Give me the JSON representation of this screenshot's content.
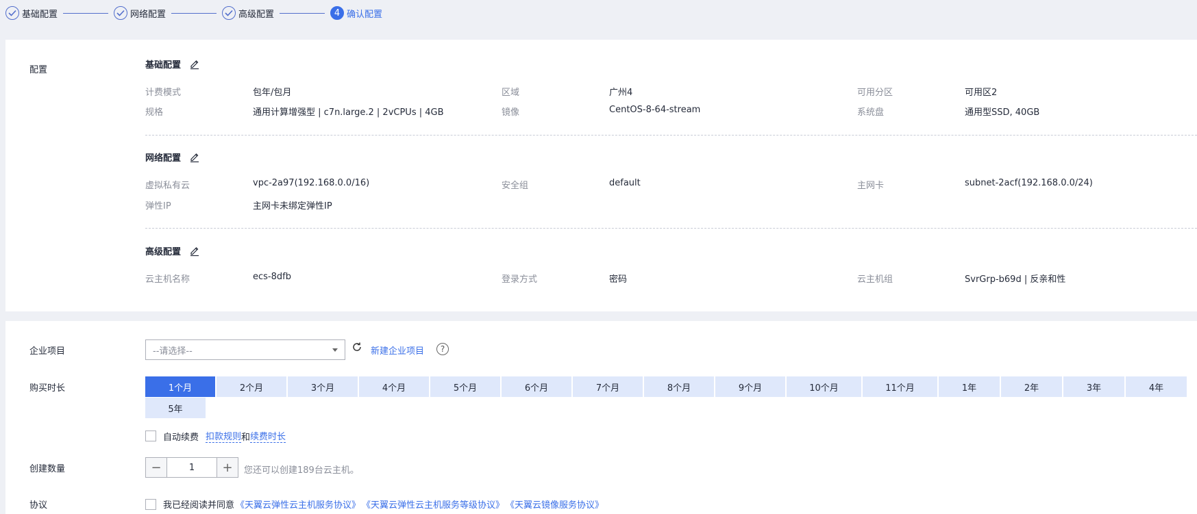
{
  "steps": [
    {
      "label": "基础配置",
      "state": "done"
    },
    {
      "label": "网络配置",
      "state": "done"
    },
    {
      "label": "高级配置",
      "state": "done"
    },
    {
      "label": "确认配置",
      "number": "4",
      "state": "active"
    }
  ],
  "config": {
    "side_label": "配置",
    "basic": {
      "title": "基础配置",
      "rows": [
        [
          {
            "k": "计费模式",
            "v": "包年/包月"
          },
          {
            "k": "区域",
            "v": "广州4"
          },
          {
            "k": "可用分区",
            "v": "可用区2"
          }
        ],
        [
          {
            "k": "规格",
            "v": "通用计算增强型 | c7n.large.2 | 2vCPUs | 4GB"
          },
          {
            "k": "镜像",
            "v": "CentOS-8-64-stream"
          },
          {
            "k": "系统盘",
            "v": "通用型SSD, 40GB"
          }
        ]
      ]
    },
    "network": {
      "title": "网络配置",
      "rows": [
        [
          {
            "k": "虚拟私有云",
            "v": "vpc-2a97(192.168.0.0/16)"
          },
          {
            "k": "安全组",
            "v": "default"
          },
          {
            "k": "主网卡",
            "v": "subnet-2acf(192.168.0.0/24)"
          }
        ],
        [
          {
            "k": "弹性IP",
            "v": "主网卡未绑定弹性IP"
          }
        ]
      ]
    },
    "advanced": {
      "title": "高级配置",
      "rows": [
        [
          {
            "k": "云主机名称",
            "v": "ecs-8dfb"
          },
          {
            "k": "登录方式",
            "v": "密码"
          },
          {
            "k": "云主机组",
            "v": "SvrGrp-b69d | 反亲和性"
          }
        ]
      ]
    }
  },
  "form": {
    "enterprise_label": "企业项目",
    "enterprise_placeholder": "--请选择--",
    "new_project_link": "新建企业项目",
    "help_glyph": "?",
    "duration_label": "购买时长",
    "durations": [
      "1个月",
      "2个月",
      "3个月",
      "4个月",
      "5个月",
      "6个月",
      "7个月",
      "8个月",
      "9个月",
      "10个月",
      "11个月",
      "1年",
      "2年",
      "3年",
      "4年",
      "5年"
    ],
    "selected_duration": "1个月",
    "auto_renew_label": "自动续费",
    "deduct_rules_link": "扣款规则",
    "and_text": "和",
    "renew_duration_link": "续费时长",
    "quantity_label": "创建数量",
    "quantity_value": "1",
    "quantity_minus": "−",
    "quantity_plus": "+",
    "quantity_hint": "您还可以创建189台云主机。",
    "agreement_label": "协议",
    "agreement_text": "我已经阅读并同意",
    "agreement_links": [
      "《天翼云弹性云主机服务协议》",
      "《天翼云弹性云主机服务等级协议》",
      "《天翼云镜像服务协议》"
    ]
  },
  "colors": {
    "accent": "#3a6fe8",
    "duration_bg": "#dfe8fb",
    "page_bg": "#eef0f5"
  },
  "icons": {
    "done_step": "check-circle-icon",
    "edit": "pencil-icon",
    "refresh": "refresh-icon",
    "help": "question-circle-icon",
    "dropdown": "caret-down-icon"
  }
}
